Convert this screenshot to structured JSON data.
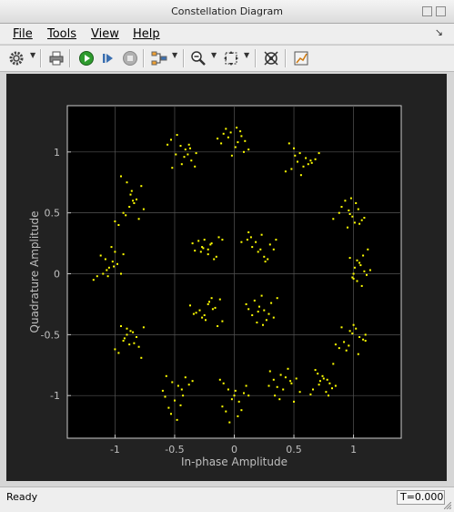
{
  "window": {
    "title": "Constellation Diagram"
  },
  "menu": {
    "file": "File",
    "tools": "Tools",
    "view": "View",
    "help": "Help"
  },
  "toolbar": {
    "icons": [
      "gear-icon",
      "printer-icon",
      "run-icon",
      "step-forward-icon",
      "stop-icon",
      "data-cursor-icon",
      "zoom-icon",
      "fit-to-view-icon",
      "configure-icon",
      "style-icon"
    ]
  },
  "status": {
    "text": "Ready",
    "time": "T=0.000"
  },
  "colors": {
    "plot_background": "#000000",
    "figure_background": "#222222",
    "grid": "#555555",
    "axis_text": "#bfbfbf",
    "points": "#ffff00"
  },
  "chart_data": {
    "type": "scatter",
    "title": "",
    "xlabel": "In-phase Amplitude",
    "ylabel": "Quadrature Amplitude",
    "xlim": [
      -1.4,
      1.4
    ],
    "ylim": [
      -1.35,
      1.38
    ],
    "xticks": [
      -1,
      -0.5,
      0,
      0.5,
      1
    ],
    "yticks": [
      -1,
      -0.5,
      0,
      0.5,
      1
    ],
    "xtick_labels": [
      "-1",
      "-0.5",
      "0",
      "0.5",
      "1"
    ],
    "ytick_labels": [
      "-1",
      "-0.5",
      "0",
      "0.5",
      "1"
    ],
    "grid": true,
    "series": [
      {
        "x": [
          -0.56,
          -0.53,
          -0.48,
          -0.45,
          -0.41,
          -0.39,
          -0.36,
          -0.33,
          -0.42,
          -0.49,
          -0.38,
          -0.32,
          -0.52,
          -0.44,
          -0.37,
          -0.14,
          -0.11,
          -0.07,
          -0.03,
          0.02,
          0.06,
          0.09,
          0.01,
          -0.05,
          0.08,
          0.03,
          -0.09,
          0.12,
          0.05,
          -0.02,
          0.46,
          0.5,
          0.55,
          0.6,
          0.65,
          0.68,
          0.71,
          0.53,
          0.48,
          0.58,
          0.64,
          0.43,
          0.51,
          0.62,
          0.56,
          0.98,
          1.02,
          1.04,
          0.97,
          1.07,
          1.01,
          0.95,
          0.9,
          0.99,
          1.05,
          1.09,
          0.93,
          0.88,
          0.83,
          0.96,
          1.12,
          1.08,
          1.03,
          1.06,
          1.14,
          1.0,
          0.99,
          1.03,
          1.07,
          1.01,
          1.05,
          1.11,
          0.97,
          1.09,
          1.0,
          0.97,
          1.0,
          1.05,
          0.92,
          1.1,
          0.96,
          1.02,
          0.88,
          1.08,
          0.94,
          0.99,
          0.85,
          1.04,
          0.9,
          1.1,
          0.75,
          0.8,
          0.7,
          0.82,
          0.77,
          0.72,
          0.85,
          0.68,
          0.79,
          0.74,
          0.66,
          0.83,
          0.71,
          0.78,
          0.64,
          0.45,
          0.39,
          0.33,
          0.48,
          0.36,
          0.43,
          0.3,
          0.52,
          0.41,
          0.34,
          0.55,
          0.38,
          0.47,
          0.29,
          0.5,
          -0.12,
          -0.09,
          -0.05,
          0.0,
          0.04,
          0.08,
          -0.1,
          0.06,
          -0.02,
          0.1,
          -0.07,
          0.03,
          0.12,
          -0.04,
          0.01,
          -0.57,
          -0.52,
          -0.47,
          -0.43,
          -0.5,
          -0.55,
          -0.41,
          -0.6,
          -0.45,
          -0.38,
          -0.53,
          -0.48,
          -0.35,
          -0.58,
          -0.44,
          -0.95,
          -0.9,
          -0.85,
          -0.82,
          -0.93,
          -0.88,
          -0.8,
          -0.97,
          -0.87,
          -0.78,
          -0.92,
          -0.84,
          -1.0,
          -0.9,
          -0.76,
          -1.15,
          -1.1,
          -1.05,
          -1.02,
          -1.08,
          -1.12,
          -0.98,
          -1.07,
          -1.0,
          -1.03,
          -0.95,
          -1.18,
          -1.06,
          -0.93,
          -1.01,
          -0.95,
          -0.9,
          -0.86,
          -0.82,
          -0.88,
          -0.93,
          -0.8,
          -0.97,
          -0.85,
          -0.78,
          -0.91,
          -0.84,
          -1.0,
          -0.87,
          -0.76,
          -0.35,
          -0.27,
          -0.22,
          -0.28,
          -0.19,
          -0.25,
          -0.13,
          -0.22,
          -0.3,
          -0.15,
          -0.2,
          -0.26,
          -0.1,
          -0.33,
          -0.17,
          0.06,
          0.11,
          0.15,
          0.2,
          0.25,
          0.3,
          0.33,
          0.23,
          0.18,
          0.28,
          0.14,
          0.22,
          0.35,
          0.26,
          0.12,
          0.1,
          0.17,
          0.21,
          0.25,
          0.29,
          0.33,
          0.19,
          0.23,
          0.12,
          0.31,
          0.27,
          0.15,
          0.36,
          0.24,
          0.2,
          -0.37,
          -0.32,
          -0.27,
          -0.21,
          -0.16,
          -0.12,
          -0.1,
          -0.25,
          -0.18,
          -0.29,
          -0.14,
          -0.22,
          -0.34,
          -0.19,
          -0.24
        ],
        "y": [
          1.06,
          1.1,
          1.14,
          1.05,
          1.02,
          0.98,
          0.93,
          0.88,
          0.96,
          0.98,
          1.06,
          0.99,
          0.87,
          0.9,
          1.03,
          1.11,
          1.07,
          1.19,
          1.16,
          1.2,
          1.13,
          1.09,
          1.04,
          1.12,
          1.0,
          1.08,
          1.15,
          1.02,
          1.17,
          0.97,
          1.07,
          1.03,
          0.99,
          0.95,
          0.91,
          0.94,
          0.99,
          0.92,
          0.86,
          0.88,
          0.93,
          0.84,
          0.97,
          0.9,
          0.81,
          0.62,
          0.58,
          0.53,
          0.49,
          0.44,
          0.42,
          0.38,
          0.55,
          0.47,
          0.41,
          0.46,
          0.6,
          0.5,
          0.45,
          0.52,
          0.2,
          0.15,
          0.11,
          0.07,
          0.03,
          0.0,
          -0.03,
          -0.06,
          -0.1,
          0.05,
          0.09,
          -0.01,
          0.13,
          0.02,
          -0.04,
          -0.47,
          -0.42,
          -0.52,
          -0.56,
          -0.5,
          -0.59,
          -0.45,
          -0.61,
          -0.54,
          -0.63,
          -0.49,
          -0.58,
          -0.66,
          -0.44,
          -0.55,
          -0.86,
          -0.9,
          -0.82,
          -0.94,
          -0.97,
          -0.88,
          -0.92,
          -0.79,
          -1.0,
          -0.84,
          -0.95,
          -0.74,
          -0.91,
          -0.87,
          -0.99,
          -0.78,
          -0.83,
          -0.87,
          -0.9,
          -0.93,
          -0.85,
          -0.8,
          -0.86,
          -0.95,
          -1.0,
          -0.97,
          -1.03,
          -0.88,
          -0.92,
          -1.05,
          -0.87,
          -0.9,
          -0.95,
          -1.0,
          -1.05,
          -0.98,
          -1.09,
          -1.12,
          -1.03,
          -0.92,
          -1.13,
          -1.17,
          -1.0,
          -1.22,
          -0.96,
          -0.84,
          -0.89,
          -0.92,
          -1.0,
          -1.04,
          -1.1,
          -0.85,
          -0.96,
          -1.08,
          -0.91,
          -1.15,
          -1.2,
          -0.88,
          -1.01,
          -0.95,
          -0.43,
          -0.45,
          -0.48,
          -0.52,
          -0.55,
          -0.58,
          -0.6,
          -0.65,
          -0.47,
          -0.69,
          -0.53,
          -0.57,
          -0.62,
          -0.5,
          -0.44,
          -0.02,
          0.0,
          0.05,
          0.1,
          0.12,
          0.15,
          0.08,
          0.03,
          0.18,
          0.22,
          0.0,
          -0.05,
          -0.02,
          0.16,
          0.06,
          0.8,
          0.75,
          0.68,
          0.61,
          0.55,
          0.5,
          0.45,
          0.4,
          0.6,
          0.72,
          0.48,
          0.58,
          0.43,
          0.65,
          0.53,
          0.25,
          0.22,
          0.2,
          0.18,
          0.25,
          0.28,
          0.3,
          0.16,
          0.27,
          0.14,
          0.24,
          0.21,
          0.28,
          0.19,
          0.12,
          0.26,
          0.28,
          0.22,
          0.18,
          0.14,
          0.24,
          0.2,
          0.32,
          0.26,
          0.12,
          0.3,
          0.2,
          0.28,
          0.1,
          0.34,
          -0.25,
          -0.22,
          -0.27,
          -0.3,
          -0.33,
          -0.36,
          -0.4,
          -0.18,
          -0.29,
          -0.24,
          -0.38,
          -0.34,
          -0.2,
          -0.42,
          -0.31,
          -0.26,
          -0.32,
          -0.36,
          -0.23,
          -0.28,
          -0.21,
          -0.39,
          -0.34,
          -0.29,
          -0.3,
          -0.43,
          -0.25,
          -0.33,
          -0.2,
          -0.38
        ]
      }
    ]
  }
}
